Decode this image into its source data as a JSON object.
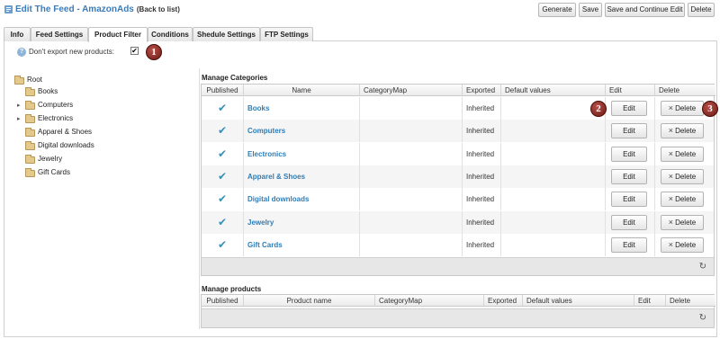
{
  "header": {
    "title": "Edit The Feed - AmazonAds",
    "back_link": "(Back to list)",
    "buttons": {
      "generate": "Generate",
      "save": "Save",
      "save_continue": "Save and Continue Edit",
      "delete": "Delete"
    }
  },
  "tabs": [
    "Info",
    "Feed Settings",
    "Product Filter",
    "Conditions",
    "Shedule Settings",
    "FTP Settings"
  ],
  "active_tab": "Product Filter",
  "options": {
    "dont_export_label": "Don't export new products:",
    "dont_export_checked": "✔"
  },
  "badges": [
    "1",
    "2",
    "3"
  ],
  "tree": {
    "root": "Root",
    "items": [
      "Books",
      "Computers",
      "Electronics",
      "Apparel & Shoes",
      "Digital downloads",
      "Jewelry",
      "Gift Cards"
    ]
  },
  "manage_categories": {
    "title": "Manage Categories",
    "headers": [
      "Published",
      "Name",
      "CategoryMap",
      "Exported",
      "Default values",
      "Edit",
      "Delete"
    ],
    "rows": [
      {
        "name": "Books",
        "exported": "Inherited"
      },
      {
        "name": "Computers",
        "exported": "Inherited"
      },
      {
        "name": "Electronics",
        "exported": "Inherited"
      },
      {
        "name": "Apparel & Shoes",
        "exported": "Inherited"
      },
      {
        "name": "Digital downloads",
        "exported": "Inherited"
      },
      {
        "name": "Jewelry",
        "exported": "Inherited"
      },
      {
        "name": "Gift Cards",
        "exported": "Inherited"
      }
    ],
    "edit_label": "Edit",
    "delete_label": "Delete"
  },
  "manage_products": {
    "title": "Manage products",
    "headers": [
      "Published",
      "Product name",
      "CategoryMap",
      "Exported",
      "Default values",
      "Edit",
      "Delete"
    ]
  },
  "icons": {
    "published": "checkmark-icon",
    "refresh": "refresh-icon",
    "folder": "folder-icon",
    "help": "help-icon"
  },
  "colors": {
    "link": "#2f7db6",
    "title": "#3b7cb8",
    "badge": "#8b2a22"
  }
}
